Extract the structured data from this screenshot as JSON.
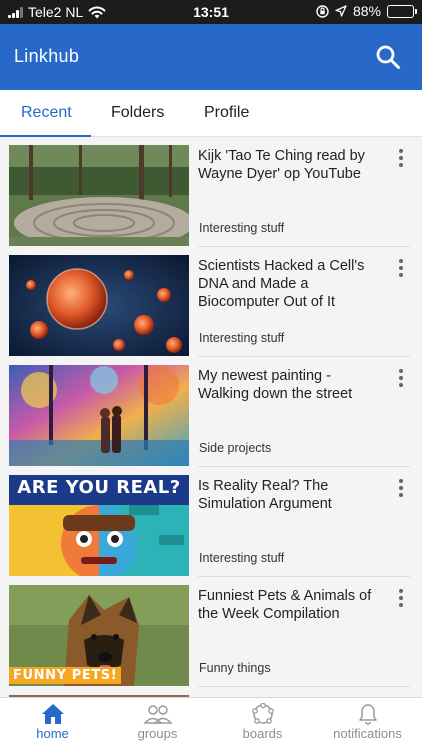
{
  "status_bar": {
    "carrier": "Tele2 NL",
    "time": "13:51",
    "battery": "88%",
    "battery_level": 0.88
  },
  "app_bar": {
    "title": "Linkhub",
    "search_icon": "search-icon"
  },
  "tabs": [
    {
      "label": "Recent",
      "active": true
    },
    {
      "label": "Folders",
      "active": false
    },
    {
      "label": "Profile",
      "active": false
    }
  ],
  "links": [
    {
      "title": "Kijk 'Tao Te Ching read by Wayne Dyer' op YouTube",
      "folder": "Interesting stuff"
    },
    {
      "title": "Scientists Hacked a Cell's DNA and Made a Biocomputer Out of It",
      "folder": "Interesting stuff"
    },
    {
      "title": "My newest painting - Walking down the street",
      "folder": "Side projects"
    },
    {
      "title": "Is Reality Real? The Simulation Argument",
      "folder": "Interesting stuff",
      "thumb_text": "ARE YOU REAL?"
    },
    {
      "title": "Funniest Pets & Animals of the Week Compilation",
      "folder": "Funny things",
      "thumb_text": "FUNNY PETS!"
    }
  ],
  "bottom_nav": [
    {
      "label": "home",
      "icon": "home-icon",
      "active": true
    },
    {
      "label": "groups",
      "icon": "groups-icon",
      "active": false
    },
    {
      "label": "boards",
      "icon": "boards-icon",
      "active": false
    },
    {
      "label": "notifications",
      "icon": "bell-icon",
      "active": false
    }
  ],
  "colors": {
    "accent": "#2768c9",
    "status_bar": "#1c1c1e"
  }
}
